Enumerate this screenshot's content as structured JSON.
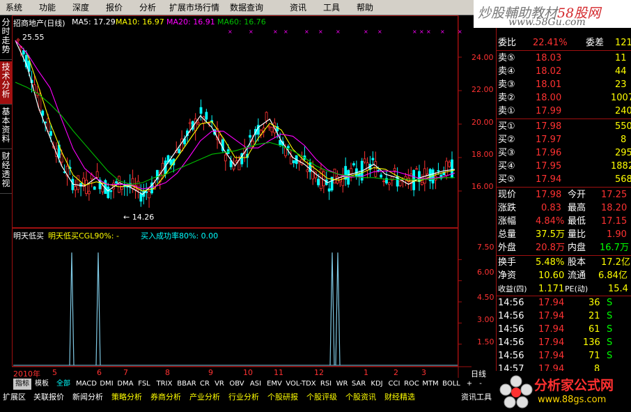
{
  "menu": [
    "系统",
    "功能",
    "深度",
    "报价",
    "分析",
    "扩展市场行情",
    "数据查询",
    "资讯",
    "工具",
    "帮助"
  ],
  "brand": {
    "line1_a": "炒股輔助教材",
    "line1_b": "58股网",
    "line2": "www.58Gu.com"
  },
  "left_tabs": [
    "分时走势",
    "技术分析",
    "基本资料",
    "财经透视"
  ],
  "main_chart": {
    "stock": "招商地产(日线)",
    "ma5": "MA5: 17.29",
    "ma10": "MA10: 16.97",
    "ma20": "MA20: 16.91",
    "ma60": "MA60: 16.76",
    "high_label": "25.55",
    "low_label": "← 14.26",
    "y_labels": [
      "24.00",
      "22.00",
      "20.00",
      "18.00",
      "16.00"
    ]
  },
  "sub_chart": {
    "title": "明天低买",
    "formula": "明天低买CGL90%: -",
    "text": "买入成功率80%: 0.00",
    "y_labels": [
      "7.50",
      "6.00",
      "4.50",
      "3.00",
      "1.50"
    ]
  },
  "x_axis": {
    "labels": [
      "2010年",
      "5",
      "6",
      "7",
      "8",
      "9",
      "10",
      "11",
      "12",
      "1",
      "2",
      "3"
    ],
    "period": "日线"
  },
  "chart_data": [
    {
      "type": "line",
      "title": "招商地产(日线)",
      "ylim": [
        14.0,
        26.0
      ],
      "series": [
        {
          "name": "MA5",
          "values": [
            25.0,
            23.5,
            21.0,
            19.2,
            17.5,
            16.4,
            16.3,
            16.8,
            16.0,
            16.5,
            16.2,
            15.8,
            16.5,
            17.5,
            18.5,
            19.5,
            20.5,
            19.8,
            18.5,
            17.5,
            18.5,
            19.8,
            20.3,
            19.0,
            18.0,
            17.6,
            17.0,
            16.5,
            16.8,
            17.0,
            17.2,
            17.6,
            17.0,
            16.8,
            16.4,
            16.8,
            17.0,
            17.2,
            17.3
          ]
        },
        {
          "name": "MA60",
          "values": [
            22.5,
            22.2,
            21.8,
            21.2,
            20.5,
            19.6,
            18.8,
            18.0,
            17.2,
            16.6,
            16.4,
            16.5,
            16.8,
            17.0,
            17.3,
            17.6,
            17.9,
            18.2,
            18.3,
            18.4,
            18.6,
            18.8,
            18.9,
            18.7,
            18.4,
            18.0,
            17.5,
            17.2,
            17.0,
            16.9,
            16.8,
            16.8,
            16.7,
            16.7,
            16.7,
            16.7,
            16.7,
            16.8,
            16.8
          ]
        }
      ]
    },
    {
      "type": "bar",
      "title": "明天低买CGL90%",
      "ylim": [
        0,
        9
      ],
      "categories": [
        "5",
        "6",
        "12a",
        "12b"
      ],
      "values": [
        8.0,
        8.0,
        8.0,
        8.0
      ]
    }
  ],
  "quote": {
    "weibi_label": "委比",
    "weibi_val": "22.41%",
    "weicha_label": "委差",
    "weicha_val": "121",
    "sell": [
      [
        "卖⑤",
        "18.03",
        "11"
      ],
      [
        "卖④",
        "18.02",
        "44"
      ],
      [
        "卖③",
        "18.01",
        "23"
      ],
      [
        "卖②",
        "18.00",
        "1007"
      ],
      [
        "卖①",
        "17.99",
        "240"
      ]
    ],
    "buy": [
      [
        "买①",
        "17.98",
        "550"
      ],
      [
        "买②",
        "17.97",
        "8"
      ],
      [
        "买③",
        "17.96",
        "295"
      ],
      [
        "买④",
        "17.95",
        "1882"
      ],
      [
        "买⑤",
        "17.94",
        "568"
      ]
    ],
    "stats": [
      [
        "现价",
        "17.98",
        "今开",
        "17.25"
      ],
      [
        "涨跌",
        "0.83",
        "最高",
        "18.20"
      ],
      [
        "涨幅",
        "4.84%",
        "最低",
        "17.15"
      ],
      [
        "总量",
        "37.5万",
        "量比",
        "1.90"
      ],
      [
        "外盘",
        "20.8万",
        "内盘",
        "16.7万"
      ],
      [
        "换手",
        "5.48%",
        "股本",
        "17.2亿"
      ],
      [
        "净资",
        "10.60",
        "流通",
        "6.84亿"
      ],
      [
        "收益(四)",
        "1.171",
        "PE(动)",
        "15.4"
      ]
    ],
    "ticks": [
      [
        "14:56",
        "17.94",
        "36",
        "S"
      ],
      [
        "14:56",
        "17.94",
        "21",
        "S"
      ],
      [
        "14:56",
        "17.94",
        "61",
        "S"
      ],
      [
        "14:56",
        "17.94",
        "136",
        "S"
      ],
      [
        "14:56",
        "17.94",
        "71",
        "S"
      ],
      [
        "14:57",
        "17.94",
        "8",
        ""
      ]
    ]
  },
  "indicator_tabs": [
    "指标",
    "模板",
    "全部",
    "MACD",
    "DMI",
    "DMA",
    "FSL",
    "TRIX",
    "BBAR",
    "CR",
    "VR",
    "OBV",
    "ASI",
    "EMV",
    "VOL-TDX",
    "RSI",
    "WR",
    "SAR",
    "KDJ",
    "CCI",
    "ROC",
    "MTM",
    "BOLL",
    "+",
    "-"
  ],
  "bottom_nav": [
    "扩展区",
    "关联报价",
    "新闻分析",
    "策略分析",
    "券商分析",
    "产业分析",
    "行业分析",
    "个股研报",
    "个股评级",
    "个股资讯",
    "财经精选",
    "资讯工具"
  ],
  "logo2": {
    "name": "分析家公式网",
    "url": "www.88gs.com"
  },
  "colors": {
    "up": "#ff3232",
    "down": "#00ffff",
    "ma5": "#ffffff",
    "ma10": "#ffff00",
    "ma20": "#ff00ff",
    "ma60": "#00c000",
    "grid": "#a01010",
    "signal": "#7ec8e3"
  }
}
